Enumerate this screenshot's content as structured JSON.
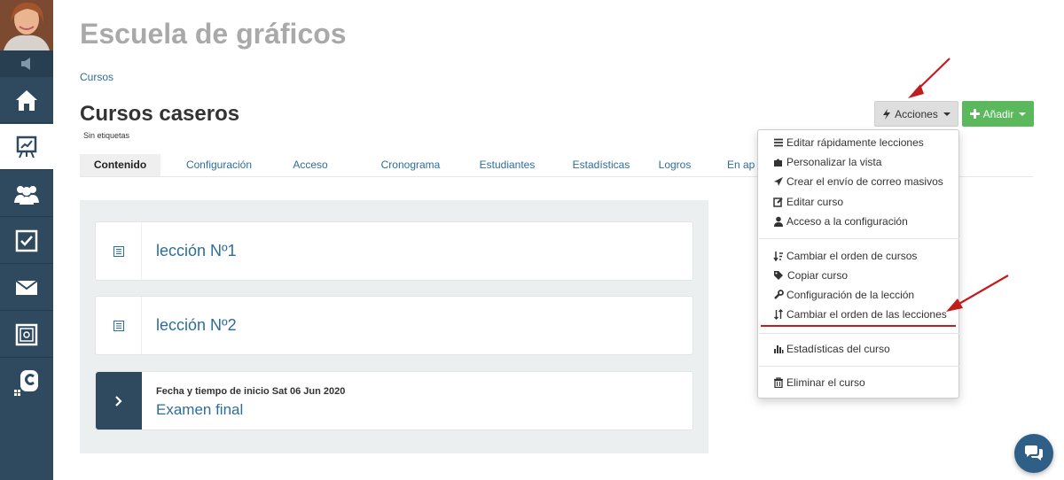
{
  "header": {
    "school_title": "Escuela de gráficos",
    "breadcrumb": "Cursos",
    "page_title": "Cursos caseros",
    "tags": "Sin etiquetas"
  },
  "tabs": [
    {
      "label": "Contenido",
      "active": true
    },
    {
      "label": "Configuración"
    },
    {
      "label": "Acceso"
    },
    {
      "label": "Cronograma"
    },
    {
      "label": "Estudiantes"
    },
    {
      "label": "Estadísticas"
    },
    {
      "label": "Logros"
    },
    {
      "label": "En ap"
    }
  ],
  "toolbar": {
    "actions_label": "Acciones",
    "add_label": "Añadir"
  },
  "lessons": [
    {
      "title": "lección Nº1",
      "icon": "document-list-icon"
    },
    {
      "title": "lección Nº2",
      "icon": "document-list-icon"
    }
  ],
  "exam": {
    "meta": "Fecha y tiempo de inicio Sat 06 Jun 2020",
    "title": "Examen final",
    "icon": "chevron-right-icon"
  },
  "dropdown": {
    "items": [
      {
        "label": "Editar rápidamente lecciones",
        "icon": "list-icon"
      },
      {
        "label": "Personalizar la vista",
        "icon": "puzzle-icon"
      },
      {
        "label": "Crear el envío de correo masivos",
        "icon": "paper-plane-icon"
      },
      {
        "label": "Editar curso",
        "icon": "edit-icon"
      },
      {
        "label": "Acceso a la configuración",
        "icon": "user-icon"
      },
      {
        "label": "Cambiar el orden de cursos",
        "icon": "sort-icon"
      },
      {
        "label": "Copiar curso",
        "icon": "tags-icon"
      },
      {
        "label": "Configuración de la lección",
        "icon": "wrench-icon"
      },
      {
        "label": "Cambiar el orden de las lecciones",
        "icon": "sort-arrows-icon"
      },
      {
        "label": "Estadísticas del curso",
        "icon": "bar-chart-icon"
      },
      {
        "label": "Eliminar el curso",
        "icon": "trash-icon"
      }
    ]
  },
  "sidebar": {
    "items": [
      {
        "icon": "home-icon"
      },
      {
        "icon": "presentation-chart-icon",
        "active": true
      },
      {
        "icon": "users-icon"
      },
      {
        "icon": "checkbox-icon"
      },
      {
        "icon": "envelope-icon"
      },
      {
        "icon": "safe-icon"
      },
      {
        "icon": "brand-logo-icon"
      }
    ]
  },
  "colors": {
    "sidebar": "#2f4a5f",
    "link": "#2d6d9b",
    "add_button": "#5cb85c",
    "annotation_red": "#c21d1d"
  }
}
